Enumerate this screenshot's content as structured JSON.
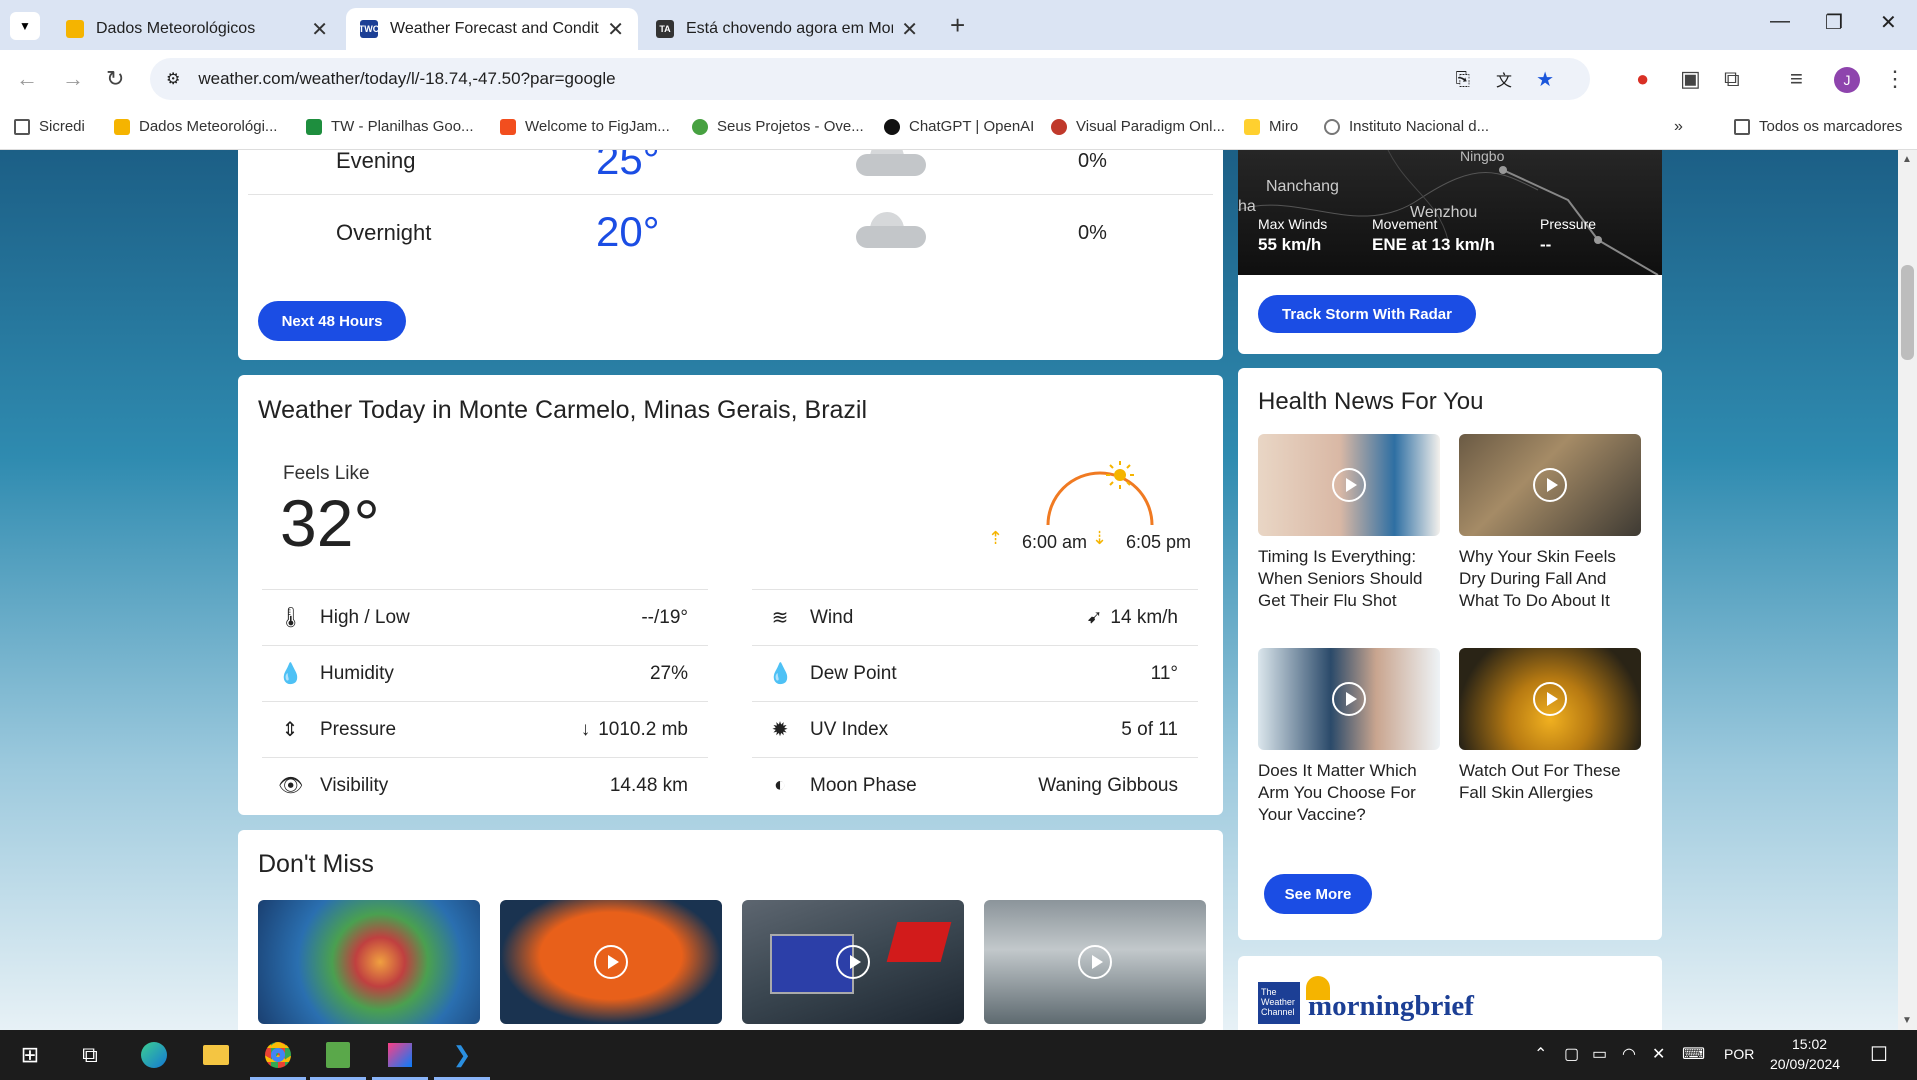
{
  "tabs": [
    {
      "title": "Dados Meteorológicos",
      "active": false
    },
    {
      "title": "Weather Forecast and Condition",
      "active": true
    },
    {
      "title": "Está chovendo agora em Monte",
      "active": false
    }
  ],
  "address": {
    "url": "weather.com/weather/today/l/-18.74,-47.50?par=google"
  },
  "bookmarks": [
    "Sicredi",
    "Dados Meteorológi...",
    "TW - Planilhas Goo...",
    "Welcome to FigJam...",
    "Seus Projetos - Ove...",
    "ChatGPT | OpenAI",
    "Visual Paradigm Onl...",
    "Miro",
    "Instituto Nacional d..."
  ],
  "all_bookmarks": "Todos os marcadores",
  "hourly": {
    "rows": [
      {
        "label": "Evening",
        "temp": "25°",
        "precip": "0%"
      },
      {
        "label": "Overnight",
        "temp": "20°",
        "precip": "0%"
      }
    ],
    "button": "Next 48 Hours"
  },
  "storm": {
    "cities": [
      "Nanchang",
      "Wenzhou",
      "Ningbo",
      "ha"
    ],
    "stats": [
      {
        "label": "Max Winds",
        "value": "55 km/h"
      },
      {
        "label": "Movement",
        "value": "ENE at 13 km/h"
      },
      {
        "label": "Pressure",
        "value": "--"
      }
    ],
    "button": "Track Storm With Radar"
  },
  "today": {
    "title": "Weather Today in Monte Carmelo, Minas Gerais, Brazil",
    "feels_label": "Feels Like",
    "feels_value": "32°",
    "sunrise": "6:00 am",
    "sunset": "6:05 pm",
    "left": [
      {
        "icon": "thermometer-icon",
        "label": "High / Low",
        "value": "--/19°"
      },
      {
        "icon": "humidity-icon",
        "label": "Humidity",
        "value": "27%"
      },
      {
        "icon": "pressure-icon",
        "label": "Pressure",
        "value": "1010.2 mb"
      },
      {
        "icon": "visibility-icon",
        "label": "Visibility",
        "value": "14.48 km"
      }
    ],
    "right": [
      {
        "icon": "wind-icon",
        "label": "Wind",
        "value": "14 km/h"
      },
      {
        "icon": "dew-point-icon",
        "label": "Dew Point",
        "value": "11°"
      },
      {
        "icon": "uv-index-icon",
        "label": "UV Index",
        "value": "5 of 11"
      },
      {
        "icon": "moon-phase-icon",
        "label": "Moon Phase",
        "value": "Waning Gibbous"
      }
    ]
  },
  "health": {
    "title": "Health News For You",
    "items": [
      "Timing Is Everything: When Seniors Should Get Their Flu Shot",
      "Why Your Skin Feels Dry During Fall And What To Do About It",
      "Does It Matter Which Arm You Choose For Your Vaccine?",
      "Watch Out For These Fall Skin Allergies"
    ],
    "button": "See More"
  },
  "dont_miss": {
    "title": "Don't Miss"
  },
  "morningbrief": {
    "logo_small": "The Weather Channel",
    "logo_text": "morningbrief"
  },
  "taskbar": {
    "lang": "POR",
    "time": "15:02",
    "date": "20/09/2024"
  },
  "colors": {
    "accent": "#1b4de4",
    "temp_blue": "#1b4de4",
    "sun_orange": "#f07a22"
  }
}
